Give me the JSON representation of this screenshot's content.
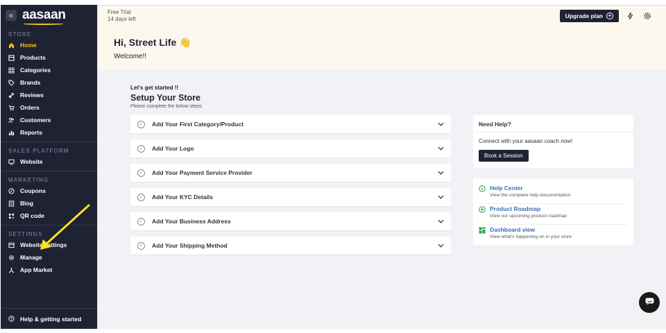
{
  "sidebar": {
    "logo": "aasaan",
    "collapse_glyph": "«",
    "sections": [
      {
        "label": "STORE",
        "items": [
          {
            "label": "Home",
            "icon": "home-icon",
            "active": true
          },
          {
            "label": "Products",
            "icon": "products-icon"
          },
          {
            "label": "Categories",
            "icon": "categories-icon"
          },
          {
            "label": "Brands",
            "icon": "tag-icon"
          },
          {
            "label": "Reviews",
            "icon": "reviews-icon"
          },
          {
            "label": "Orders",
            "icon": "cart-icon"
          },
          {
            "label": "Customers",
            "icon": "customers-icon"
          },
          {
            "label": "Reports",
            "icon": "chart-icon"
          }
        ]
      },
      {
        "label": "SALES PLATFORM",
        "items": [
          {
            "label": "Website",
            "icon": "monitor-icon"
          }
        ]
      },
      {
        "label": "MARKETING",
        "items": [
          {
            "label": "Coupons",
            "icon": "coupon-icon"
          },
          {
            "label": "Blog",
            "icon": "blog-icon"
          },
          {
            "label": "QR code",
            "icon": "qr-icon"
          }
        ]
      },
      {
        "label": "SETTINGS",
        "items": [
          {
            "label": "Website settings",
            "icon": "website-settings-icon"
          },
          {
            "label": "Manage",
            "icon": "gear-icon"
          },
          {
            "label": "App Market",
            "icon": "app-market-icon"
          }
        ]
      }
    ],
    "footer": {
      "label": "Help & getting started",
      "icon": "help-icon"
    }
  },
  "banner": {
    "trial_line1": "Free Trial",
    "trial_line2": "14 days left",
    "greeting": "Hi, Street Life 👋",
    "welcome": "Welcome!!",
    "upgrade_label": "Upgrade plan"
  },
  "setup": {
    "intro": "Let's get started !!",
    "title": "Setup Your Store",
    "subtitle": "Please complete the below steps:",
    "steps": [
      "Add Your First Category/Product",
      "Add Your Logo",
      "Add Your Payment Service Provider",
      "Add Your KYC Details",
      "Add Your Business Address",
      "Add Your Shipping Method"
    ]
  },
  "help_card": {
    "title": "Need Help?",
    "text": "Connect with your aasaan coach now!",
    "button": "Book a Session"
  },
  "links": [
    {
      "title": "Help Center",
      "desc": "View the complete help documentation",
      "icon": "info-icon",
      "color": "#2e9e4f"
    },
    {
      "title": "Product Roadmap",
      "desc": "View our upcoming product roadmap",
      "icon": "plus-circle-icon",
      "color": "#2e9e4f"
    },
    {
      "title": "Dashboard view",
      "desc": "View what's happening on in your store",
      "icon": "dashboard-icon",
      "color": "#2e9e4f"
    }
  ],
  "colors": {
    "sidebar_bg": "#1f2233",
    "accent": "#f5c518",
    "link": "#3b6fb6",
    "banner_bg": "#fdf8ee",
    "page_bg": "#f0f2f5"
  }
}
